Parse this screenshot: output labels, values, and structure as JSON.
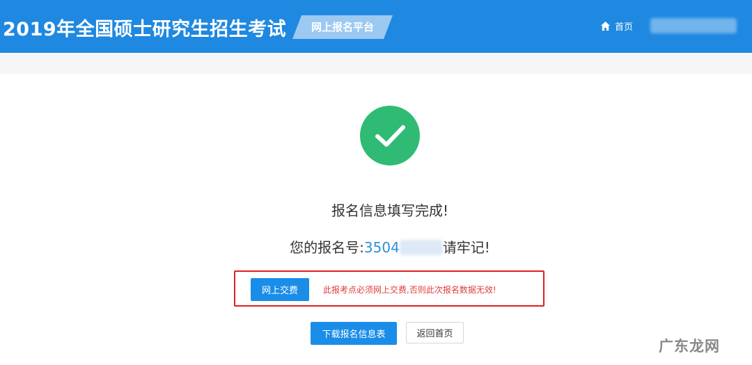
{
  "header": {
    "site_title": "2019年全国硕士研究生招生考试",
    "platform_label": "网上报名平台",
    "nav_home_label": "首页",
    "nav_home_icon": "home-icon",
    "background_color": "#1f88e0"
  },
  "main": {
    "success_icon": "check-circle-icon",
    "success_color": "#2fbb73",
    "complete_message": "报名信息填写完成!",
    "reg_prefix": "您的报名号:",
    "reg_number_visible": "3504",
    "reg_suffix": "请牢记!",
    "pay_button_label": "网上交费",
    "pay_warning": "此报考点必须网上交费,否则此次报名数据无效!",
    "download_button_label": "下载报名信息表",
    "back_home_button_label": "返回首页"
  },
  "watermark": "广东龙网",
  "colors": {
    "accent": "#1a8de8",
    "warning": "#e03a3a",
    "highlight_border": "#e02020"
  }
}
